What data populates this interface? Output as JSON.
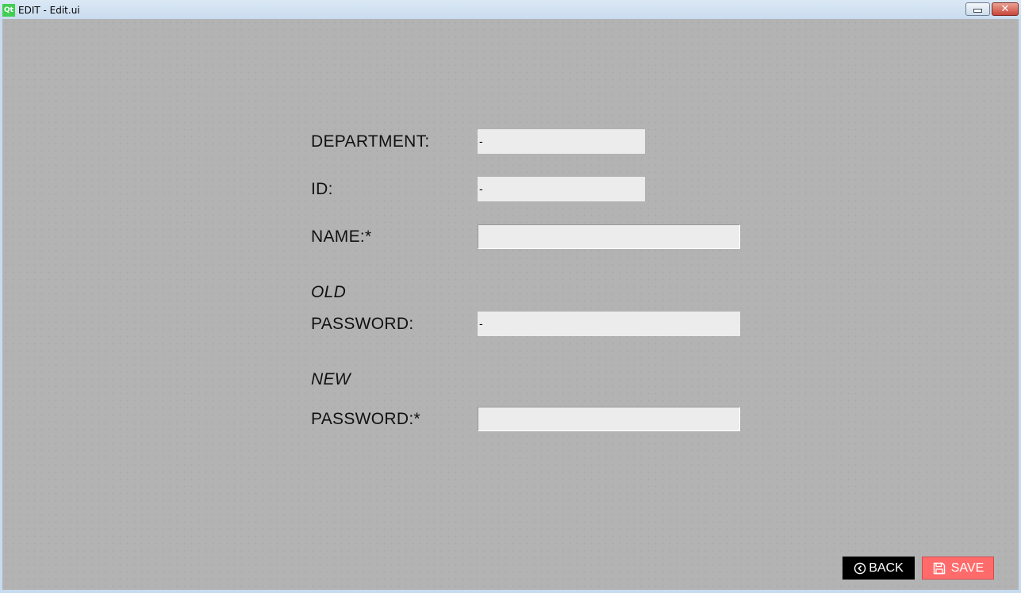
{
  "window": {
    "title": "EDIT - Edit.ui",
    "app_icon": "Qt",
    "close_glyph": "✕"
  },
  "form": {
    "department": {
      "label": "DEPARTMENT:",
      "value": "-"
    },
    "id": {
      "label": "ID:",
      "value": "-"
    },
    "name": {
      "label": "NAME:*",
      "value": ""
    },
    "old_password": {
      "label_line1": "OLD",
      "label_line2": "PASSWORD:",
      "value": "-"
    },
    "new_password": {
      "label_line1": "NEW",
      "label_line2": "PASSWORD:*",
      "value": ""
    }
  },
  "buttons": {
    "back": {
      "label": "BACK",
      "icon": "chevron-left-circle-icon"
    },
    "save": {
      "label": "SAVE",
      "icon": "floppy-disk-icon"
    }
  },
  "colors": {
    "background": "#b3b3b3",
    "save_button": "#ff6b6b",
    "back_button": "#000000",
    "field": "#ececec"
  }
}
